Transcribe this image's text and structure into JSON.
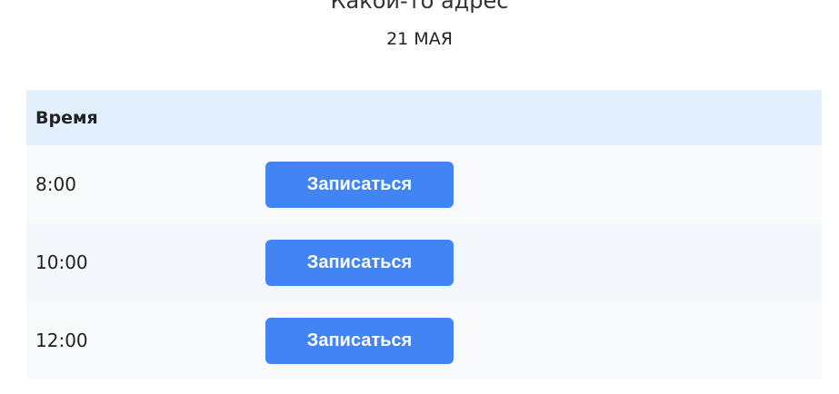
{
  "header": {
    "address": "Какой-то адрес",
    "date": "21 МАЯ"
  },
  "table": {
    "column_time": "Время",
    "rows": [
      {
        "time": "8:00",
        "button_label": "Записаться"
      },
      {
        "time": "10:00",
        "button_label": "Записаться"
      },
      {
        "time": "12:00",
        "button_label": "Записаться"
      }
    ]
  },
  "colors": {
    "accent": "#4384f4",
    "header_bg": "#e2f0fd"
  }
}
